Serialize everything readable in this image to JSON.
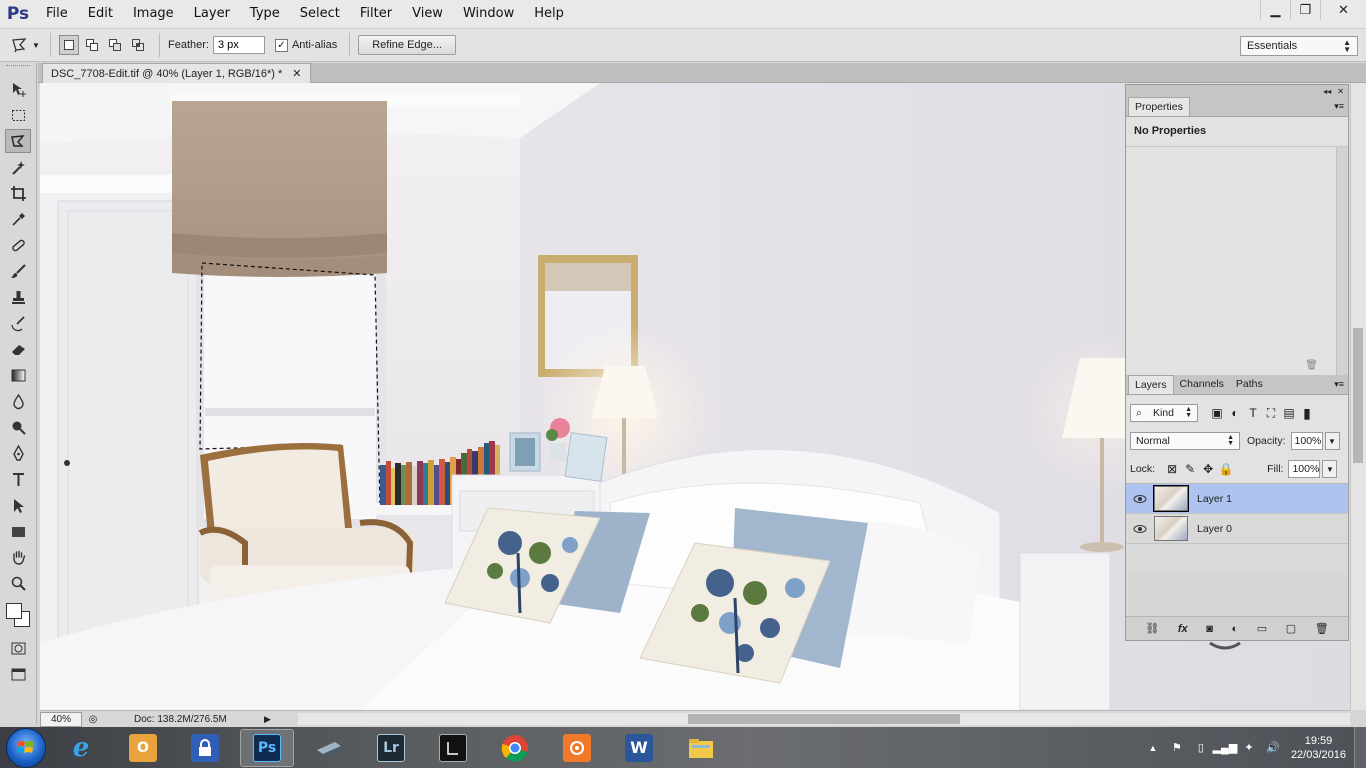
{
  "app": {
    "logo": "Ps"
  },
  "menu": [
    "File",
    "Edit",
    "Image",
    "Layer",
    "Type",
    "Select",
    "Filter",
    "View",
    "Window",
    "Help"
  ],
  "window_controls": {
    "minimize": "▁",
    "restore": "❐",
    "close": "✕"
  },
  "options": {
    "feather_label": "Feather:",
    "feather_value": "3 px",
    "antialias_label": "Anti-alias",
    "antialias_checked": "✓",
    "refine_edge": "Refine Edge...",
    "workspace": "Essentials"
  },
  "document": {
    "tab_title": "DSC_7708-Edit.tif @ 40% (Layer 1, RGB/16*) *",
    "tab_close": "✕"
  },
  "status": {
    "zoom": "40%",
    "doc_info": "Doc: 138.2M/276.5M"
  },
  "properties": {
    "tab": "Properties",
    "message": "No Properties"
  },
  "layers": {
    "tabs": [
      "Layers",
      "Channels",
      "Paths"
    ],
    "filter_kind": "Kind",
    "blend_mode": "Normal",
    "opacity_label": "Opacity:",
    "opacity_value": "100%",
    "lock_label": "Lock:",
    "fill_label": "Fill:",
    "fill_value": "100%",
    "items": [
      {
        "name": "Layer 1",
        "selected": true
      },
      {
        "name": "Layer 0",
        "selected": false
      }
    ],
    "footer_fx": "fx"
  },
  "taskbar": {
    "apps": [
      {
        "icon": "internet-explorer-icon",
        "label": "e"
      },
      {
        "icon": "outlook-icon",
        "label": "O"
      },
      {
        "icon": "keepass-icon",
        "label": ""
      },
      {
        "icon": "photoshop-icon",
        "label": "Ps"
      },
      {
        "icon": "scanner-icon",
        "label": ""
      },
      {
        "icon": "lightroom-icon",
        "label": "Lr"
      },
      {
        "icon": "app-icon",
        "label": ""
      },
      {
        "icon": "chrome-icon",
        "label": ""
      },
      {
        "icon": "camera-app-icon",
        "label": ""
      },
      {
        "icon": "word-icon",
        "label": "W"
      },
      {
        "icon": "explorer-icon",
        "label": ""
      }
    ],
    "time": "19:59",
    "date": "22/03/2016"
  },
  "colors": {
    "selected_layer": "#aec3ef",
    "ps_blue": "#2b3a8a"
  }
}
